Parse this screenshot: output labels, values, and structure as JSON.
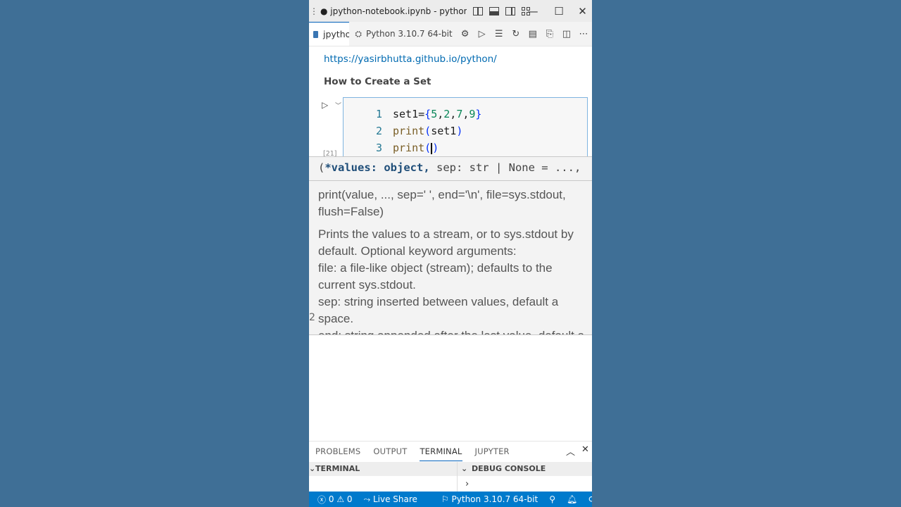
{
  "window": {
    "menu_glyph": "⋮",
    "title": "● jpython-notebook.ipynb - python...",
    "minimize": "—",
    "maximize": "☐",
    "close": "✕"
  },
  "tab": {
    "label": "jpython",
    "kernel_label": "Python 3.10.7 64-bit"
  },
  "notebook": {
    "link_text": "https://yasirbhutta.github.io/python/",
    "heading": "How to Create a Set",
    "exec_count": "[21]",
    "lines": [
      {
        "num": "1",
        "parts": [
          "set1=",
          "{",
          "5",
          ",",
          "2",
          ",",
          "7",
          ",",
          "9",
          "}"
        ]
      },
      {
        "num": "2",
        "parts": [
          "print",
          "(",
          "set1",
          ")"
        ]
      },
      {
        "num": "3",
        "parts": [
          "print",
          "(",
          ")"
        ]
      }
    ]
  },
  "hover": {
    "signature_open": "(",
    "signature_param": "*values: object,",
    "signature_rest": " sep: str | None = ...,",
    "doc_sig": "print(value, ..., sep=' ', end='\\n', file=sys.stdout, flush=False)",
    "doc_desc": "Prints the values to a stream, or to sys.stdout by default. Optional keyword arguments:",
    "doc_file": "file: a file-like object (stream); defaults to the current sys.stdout.",
    "doc_sep": "sep: string inserted between values, default a space.",
    "doc_end": "end: string appended after the last value, default a newline.",
    "left_glyph": "2"
  },
  "panel": {
    "tabs": [
      "PROBLEMS",
      "OUTPUT",
      "TERMINAL",
      "JUPYTER"
    ],
    "active_tab": "TERMINAL",
    "terminal_heading": "TERMINAL",
    "debug_heading": "DEBUG CONSOLE",
    "prompt": "›"
  },
  "status": {
    "errors": "0",
    "warnings": "0",
    "live_share": "Live Share",
    "interpreter": "Python 3.10.7 64-bit"
  },
  "colors": {
    "background": "#3f6f96",
    "status_bar": "#007acc",
    "link": "#006ab1"
  }
}
